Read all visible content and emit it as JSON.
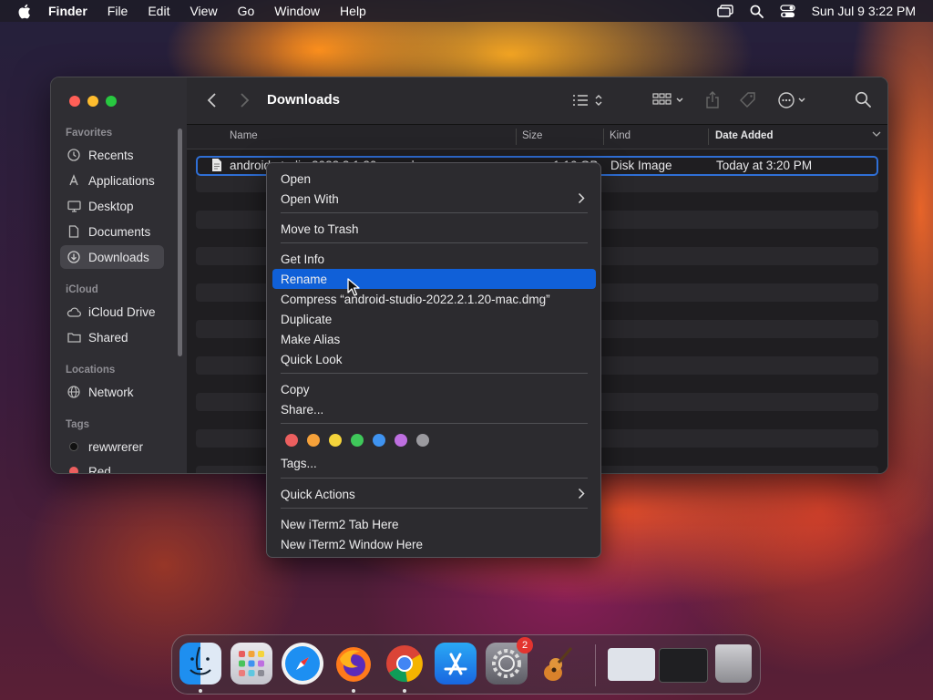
{
  "menubar": {
    "app_name": "Finder",
    "items": [
      "File",
      "Edit",
      "View",
      "Go",
      "Window",
      "Help"
    ],
    "clock": "Sun Jul 9  3:22 PM"
  },
  "finder": {
    "title": "Downloads",
    "sidebar": {
      "favorites_label": "Favorites",
      "favorites": [
        "Recents",
        "Applications",
        "Desktop",
        "Documents",
        "Downloads"
      ],
      "icloud_label": "iCloud",
      "icloud": [
        "iCloud Drive",
        "Shared"
      ],
      "locations_label": "Locations",
      "locations": [
        "Network"
      ],
      "tags_label": "Tags",
      "tags": [
        "rewwrerer",
        "Red"
      ]
    },
    "columns": [
      "Name",
      "Size",
      "Kind",
      "Date Added"
    ],
    "file": {
      "name": "android-studio-2022.2.1.20-mac.dmg",
      "size": "1.16 GB",
      "kind": "Disk Image",
      "date_added": "Today at 3:20 PM"
    }
  },
  "context_menu": {
    "open": "Open",
    "open_with": "Open With",
    "move_to_trash": "Move to Trash",
    "get_info": "Get Info",
    "rename": "Rename",
    "compress": "Compress “android-studio-2022.2.1.20-mac.dmg”",
    "duplicate": "Duplicate",
    "make_alias": "Make Alias",
    "quick_look": "Quick Look",
    "copy": "Copy",
    "share": "Share...",
    "tag_colors": [
      "#ec5f5f",
      "#f5a13a",
      "#f5d43b",
      "#3fc85a",
      "#3f93f0",
      "#be6fe0",
      "#9b9a9f"
    ],
    "tags": "Tags...",
    "quick_actions": "Quick Actions",
    "iterm_tab": "New iTerm2 Tab Here",
    "iterm_window": "New iTerm2 Window Here"
  },
  "dock": {
    "apps": [
      "Finder",
      "Launchpad",
      "Safari",
      "Firefox",
      "Chrome",
      "App Store",
      "System Settings",
      "GarageBand"
    ],
    "settings_badge": "2"
  }
}
